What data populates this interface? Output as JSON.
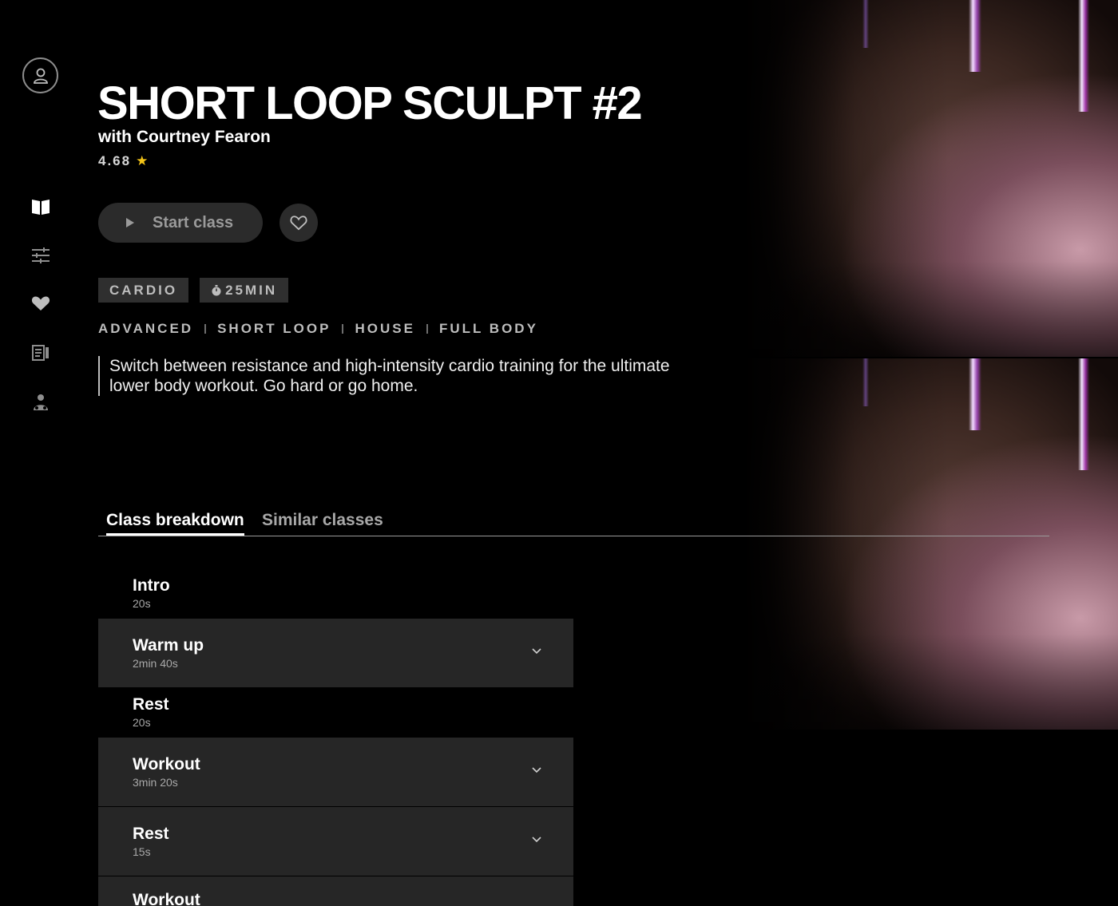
{
  "class": {
    "title": "SHORT LOOP SCULPT #2",
    "instructor": "with Courtney Fearon",
    "rating": "4.68",
    "start_label": "Start class",
    "badges": {
      "category": "CARDIO",
      "duration": "25MIN"
    },
    "tags": [
      "ADVANCED",
      "SHORT LOOP",
      "HOUSE",
      "FULL BODY"
    ],
    "description": "Switch between resistance and high-intensity cardio training for the ultimate lower body workout. Go hard or go home."
  },
  "sidebar": {
    "icons": [
      "user-icon",
      "book-icon",
      "filter-sliders-icon",
      "heart-icon",
      "schedule-icon",
      "trainer-icon"
    ]
  },
  "tabs": [
    {
      "label": "Class breakdown",
      "active": true
    },
    {
      "label": "Similar classes",
      "active": false
    }
  ],
  "breakdown": [
    {
      "name": "Intro",
      "duration": "20s",
      "expandable": false
    },
    {
      "name": "Warm up",
      "duration": "2min 40s",
      "expandable": true
    },
    {
      "name": "Rest",
      "duration": "20s",
      "expandable": false
    },
    {
      "name": "Workout",
      "duration": "3min 20s",
      "expandable": true
    },
    {
      "name": "Rest",
      "duration": "15s",
      "expandable": true
    },
    {
      "name": "Workout",
      "duration": "",
      "expandable": true
    }
  ],
  "colors": {
    "background": "#000000",
    "panel": "#262626",
    "star": "#f5c518",
    "button": "#2b2b2b"
  }
}
